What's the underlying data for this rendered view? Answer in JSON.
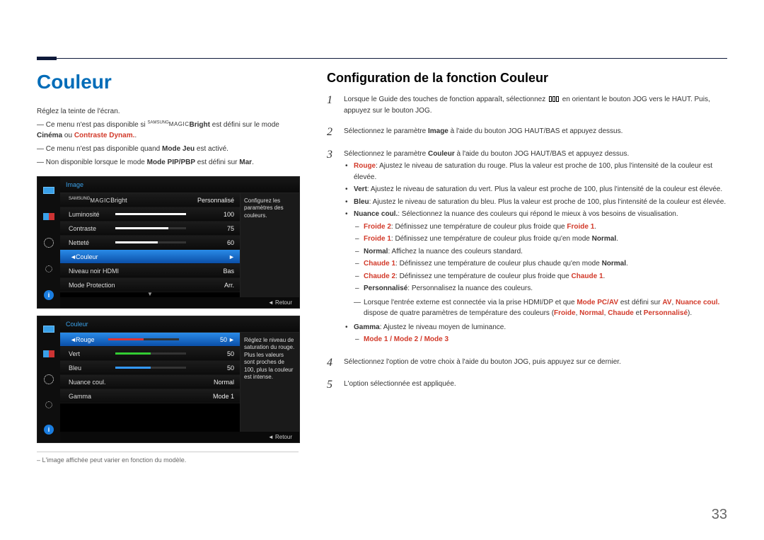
{
  "page_number": "33",
  "left": {
    "title": "Couleur",
    "intro": "Réglez la teinte de l'écran.",
    "note1_a": "Ce menu n'est pas disponible si ",
    "note1_magic_sup": "SAMSUNG",
    "note1_magic": "MAGIC",
    "note1_bright": "Bright",
    "note1_b": " est défini sur le mode ",
    "note1_cinema": "Cinéma",
    "note1_c": " ou ",
    "note1_contraste": "Contraste Dynam.",
    "note1_d": ".",
    "note2_a": "Ce menu n'est pas disponible quand ",
    "note2_mode": "Mode Jeu",
    "note2_b": " est activé.",
    "note3_a": "Non disponible lorsque le mode ",
    "note3_pip": "Mode PIP/PBP",
    "note3_b": " est défini sur ",
    "note3_mar": "Mar",
    "note3_c": ".",
    "osd1": {
      "header": "Image",
      "tip": "Configurez les paramètres des couleurs.",
      "rows": [
        {
          "label_pre": "",
          "label": "Bright",
          "magic_sup": "SAMSUNG",
          "magic": "MAGIC",
          "val": "Personnalisé",
          "bar": null,
          "selected": false,
          "arrow": false
        },
        {
          "label": "Luminosité",
          "val": "100",
          "bar": 100,
          "selected": false,
          "arrow": false
        },
        {
          "label": "Contraste",
          "val": "75",
          "bar": 75,
          "selected": false,
          "arrow": false
        },
        {
          "label": "Netteté",
          "val": "60",
          "bar": 60,
          "selected": false,
          "arrow": false
        },
        {
          "label": "Couleur",
          "val": "",
          "bar": null,
          "selected": true,
          "arrow": true
        },
        {
          "label": "Niveau noir HDMI",
          "val": "Bas",
          "bar": null,
          "selected": false,
          "arrow": false
        },
        {
          "label": "Mode Protection",
          "val": "Arr.",
          "bar": null,
          "selected": false,
          "arrow": false
        }
      ],
      "foot": "Retour"
    },
    "osd2": {
      "header": "Couleur",
      "tip": "Réglez le niveau de saturation du rouge. Plus les valeurs sont proches de 100, plus la couleur est intense.",
      "rows": [
        {
          "label": "Rouge",
          "val": "50",
          "bar": 50,
          "color": "red",
          "selected": true,
          "arrow": true
        },
        {
          "label": "Vert",
          "val": "50",
          "bar": 50,
          "color": "green",
          "selected": false,
          "arrow": false
        },
        {
          "label": "Bleu",
          "val": "50",
          "bar": 50,
          "color": "blue",
          "selected": false,
          "arrow": false
        },
        {
          "label": "Nuance coul.",
          "val": "Normal",
          "bar": null,
          "selected": false,
          "arrow": false
        },
        {
          "label": "Gamma",
          "val": "Mode 1",
          "bar": null,
          "selected": false,
          "arrow": false
        }
      ],
      "foot": "Retour"
    },
    "footnote": "L'image affichée peut varier en fonction du modèle."
  },
  "right": {
    "title": "Configuration de la fonction Couleur",
    "steps": {
      "s1a": "Lorsque le Guide des touches de fonction apparaît, sélectionnez ",
      "s1b": " en orientant le bouton JOG vers le HAUT. Puis, appuyez sur le bouton JOG.",
      "s2a": "Sélectionnez le paramètre ",
      "s2_img": "Image",
      "s2b": " à l'aide du bouton JOG HAUT/BAS et appuyez dessus.",
      "s3a": "Sélectionnez le paramètre ",
      "s3_col": "Couleur",
      "s3b": " à l'aide du bouton JOG HAUT/BAS et appuyez dessus.",
      "rouge_lbl": "Rouge",
      "rouge_txt": ": Ajustez le niveau de saturation du rouge. Plus la valeur est proche de 100, plus l'intensité de la couleur est élevée.",
      "vert_lbl": "Vert",
      "vert_txt": ": Ajustez le niveau de saturation du vert. Plus la valeur est proche de 100, plus l'intensité de la couleur est élevée.",
      "bleu_lbl": "Bleu",
      "bleu_txt": ": Ajustez le niveau de saturation du bleu. Plus la valeur est proche de 100, plus l'intensité de la couleur est élevée.",
      "nuance_lbl": "Nuance coul.",
      "nuance_txt": ": Sélectionnez la nuance des couleurs qui répond le mieux à vos besoins de visualisation.",
      "froide2_lbl": "Froide 2",
      "froide2_txt": ": Définissez une température de couleur plus froide que ",
      "froide2_end": "Froide 1",
      "froide2_dot": ".",
      "froide1_lbl": "Froide 1",
      "froide1_txt": ": Définissez une température de couleur plus froide qu'en mode ",
      "froide1_end": "Normal",
      "froide1_dot": ".",
      "normal_lbl": "Normal",
      "normal_txt": ": Affichez la nuance des couleurs standard.",
      "chaude1_lbl": "Chaude 1",
      "chaude1_txt": ": Définissez une température de couleur plus chaude qu'en mode ",
      "chaude1_end": "Normal",
      "chaude1_dot": ".",
      "chaude2_lbl": "Chaude 2",
      "chaude2_txt": ": Définissez une température de couleur plus froide que ",
      "chaude2_end": "Chaude 1",
      "chaude2_dot": ".",
      "perso_lbl": "Personnalisé",
      "perso_txt": ": Personnalisez la nuance des couleurs.",
      "ext_note_a": "Lorsque l'entrée externe est connectée via la prise HDMI/DP et que ",
      "ext_note_pcav": "Mode PC/AV",
      "ext_note_b": " est défini sur ",
      "ext_note_av": "AV",
      "ext_note_c": ", ",
      "ext_note_nuance": "Nuance coul.",
      "ext_note_d": " dispose de quatre paramètres de température des couleurs (",
      "ext_note_froide": "Froide",
      "ext_note_e": ", ",
      "ext_note_normal": "Normal",
      "ext_note_f": ", ",
      "ext_note_chaude": "Chaude",
      "ext_note_g": " et ",
      "ext_note_perso": "Personnalisé",
      "ext_note_h": ").",
      "gamma_lbl": "Gamma",
      "gamma_txt": ": Ajustez le niveau moyen de luminance.",
      "gamma_modes": "Mode 1 / Mode 2 / Mode 3",
      "s4": "Sélectionnez l'option de votre choix à l'aide du bouton JOG, puis appuyez sur ce dernier.",
      "s5": "L'option sélectionnée est appliquée."
    },
    "nums": {
      "n1": "1",
      "n2": "2",
      "n3": "3",
      "n4": "4",
      "n5": "5"
    }
  }
}
